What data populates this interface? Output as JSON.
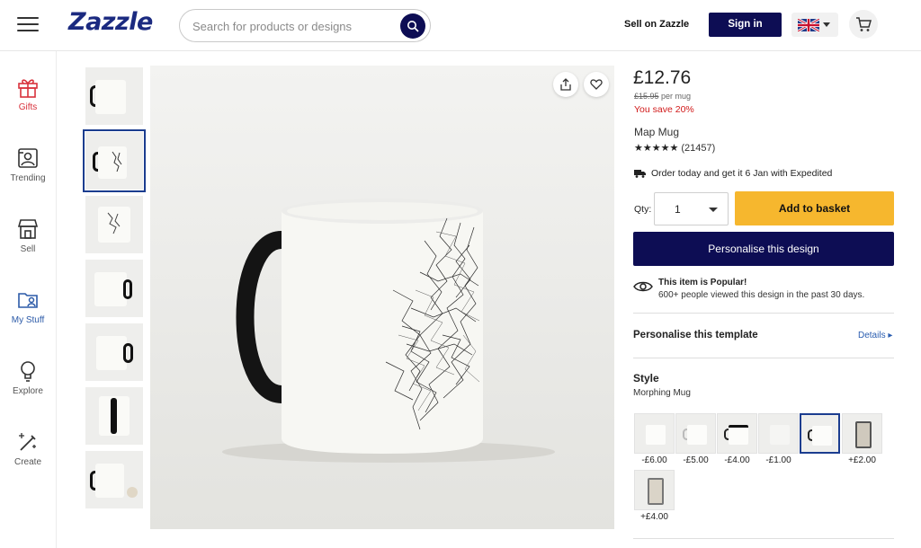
{
  "header": {
    "logo": "Zazzle",
    "search_placeholder": "Search for products or designs",
    "sell_link": "Sell on Zazzle",
    "signin_label": "Sign in",
    "locale_icon": "uk-flag-icon",
    "cart_icon": "cart-icon"
  },
  "leftnav": {
    "items": [
      {
        "label": "Gifts",
        "icon": "gift-icon"
      },
      {
        "label": "Trending",
        "icon": "trending-icon"
      },
      {
        "label": "Sell",
        "icon": "shop-icon"
      },
      {
        "label": "My Stuff",
        "icon": "folder-user-icon"
      },
      {
        "label": "Explore",
        "icon": "lightbulb-icon"
      },
      {
        "label": "Create",
        "icon": "wand-icon"
      }
    ]
  },
  "product": {
    "price": "£12.76",
    "original_price": "£15.95",
    "price_unit": "per mug",
    "savings": "You save 20%",
    "name": "Map Mug",
    "stars": "★★★★★",
    "review_count": "(21457)",
    "delivery": "Order today and get it 6 Jan with Expedited",
    "qty_label": "Qty:",
    "qty_value": "1",
    "add_to_basket": "Add to basket",
    "personalise_button": "Personalise this design",
    "popular_title": "This item is Popular!",
    "popular_sub": "600+ people viewed this design in the past 30 days.",
    "personalise_template": "Personalise this template",
    "details_link": "Details ▸",
    "style_title": "Style",
    "style_selected": "Morphing Mug",
    "style_options": [
      {
        "price": "-£6.00"
      },
      {
        "price": "-£5.00"
      },
      {
        "price": "-£4.00"
      },
      {
        "price": "-£1.00"
      },
      {
        "price": ""
      },
      {
        "price": "+£2.00"
      },
      {
        "price": "+£4.00"
      }
    ]
  },
  "colors": {
    "brand_navy": "#0d0d54",
    "basket_yellow": "#f6b72e",
    "sale_red": "#d11a1a",
    "link_blue": "#2a5db0"
  }
}
